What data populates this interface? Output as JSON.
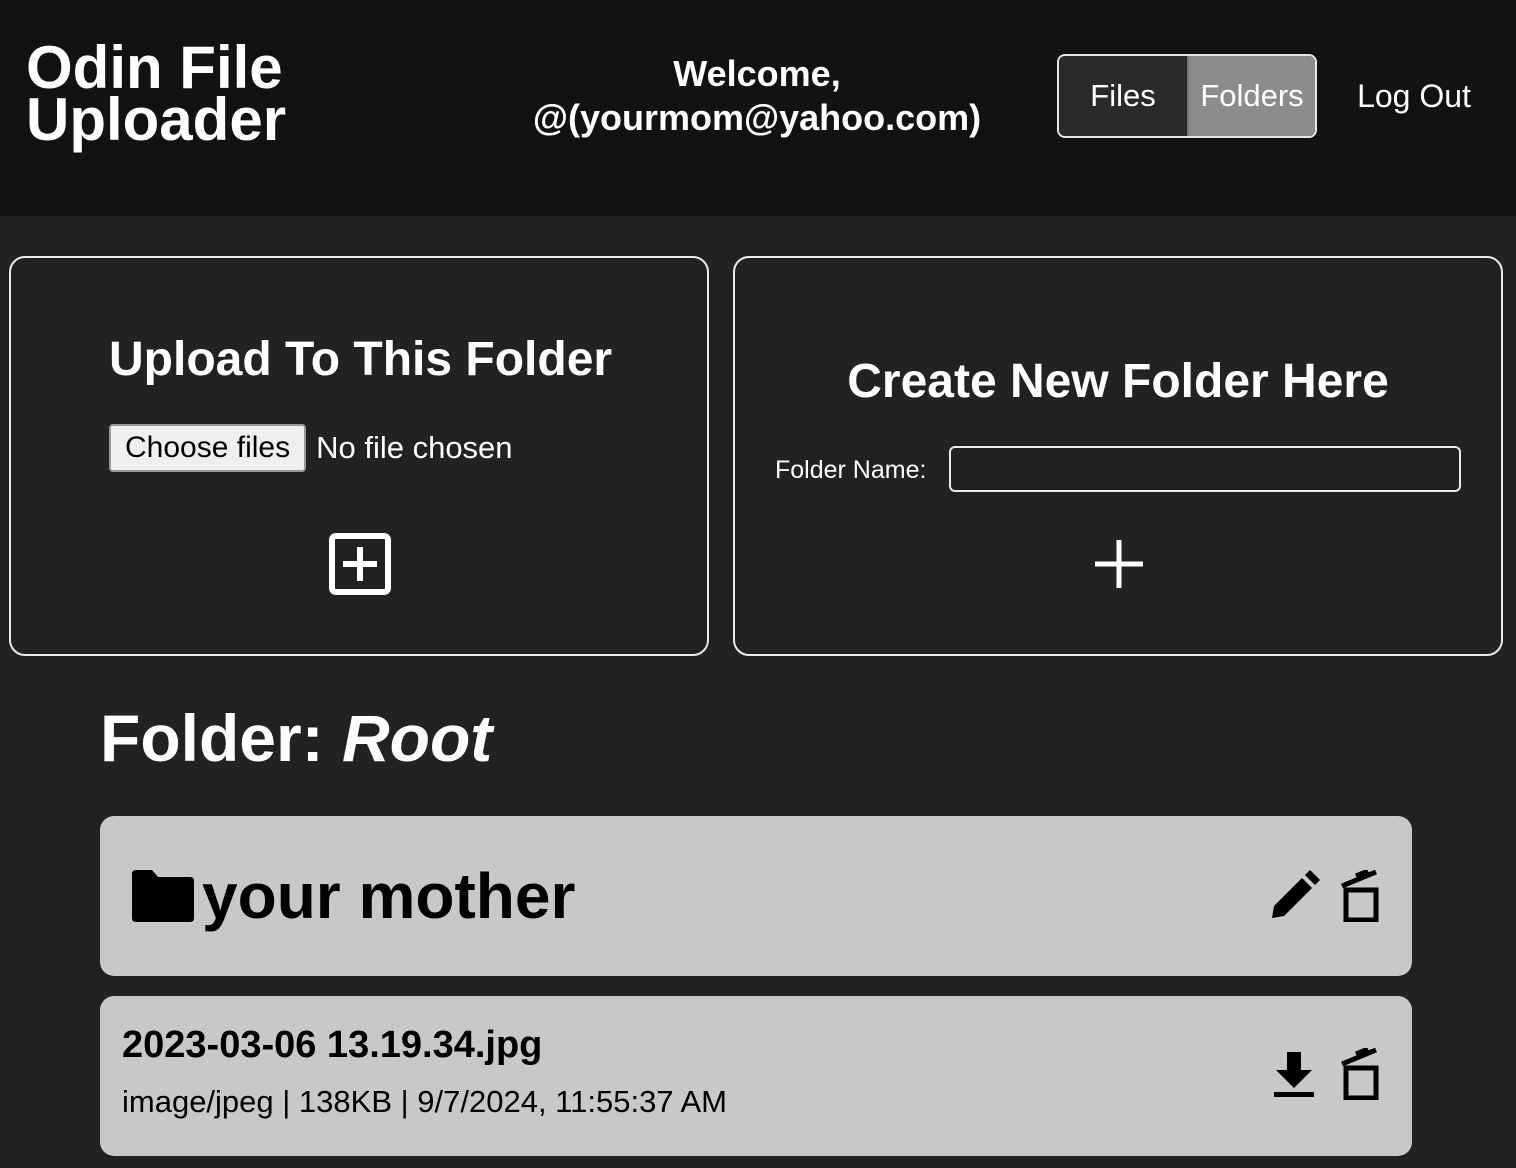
{
  "header": {
    "app_title": "Odin File Uploader",
    "welcome_line1": "Welcome,",
    "welcome_line2": "@(yourmom@yahoo.com)",
    "nav": {
      "files_label": "Files",
      "folders_label": "Folders",
      "active": "Folders"
    },
    "logout_label": "Log Out"
  },
  "upload_card": {
    "title": "Upload To This Folder",
    "choose_label": "Choose files",
    "no_file_text": "No file chosen",
    "submit_icon": "plus-square-icon"
  },
  "folder_card": {
    "title": "Create New Folder Here",
    "name_label": "Folder Name:",
    "name_value": "",
    "submit_icon": "plus-icon"
  },
  "current_folder": {
    "prefix": "Folder:",
    "name": "Root"
  },
  "items": [
    {
      "type": "folder",
      "name": "your mother",
      "icons": [
        "folder-icon",
        "pencil-icon",
        "trash-icon"
      ]
    },
    {
      "type": "file",
      "name": "2023-03-06 13.19.34.jpg",
      "meta": "image/jpeg | 138KB | 9/7/2024, 11:55:37 AM",
      "icons": [
        "download-icon",
        "trash-icon"
      ]
    }
  ],
  "colors": {
    "header_bg": "#121212",
    "page_bg": "#222223",
    "row_bg": "#c8c8c8",
    "nav_active_bg": "#8c8c8c"
  }
}
